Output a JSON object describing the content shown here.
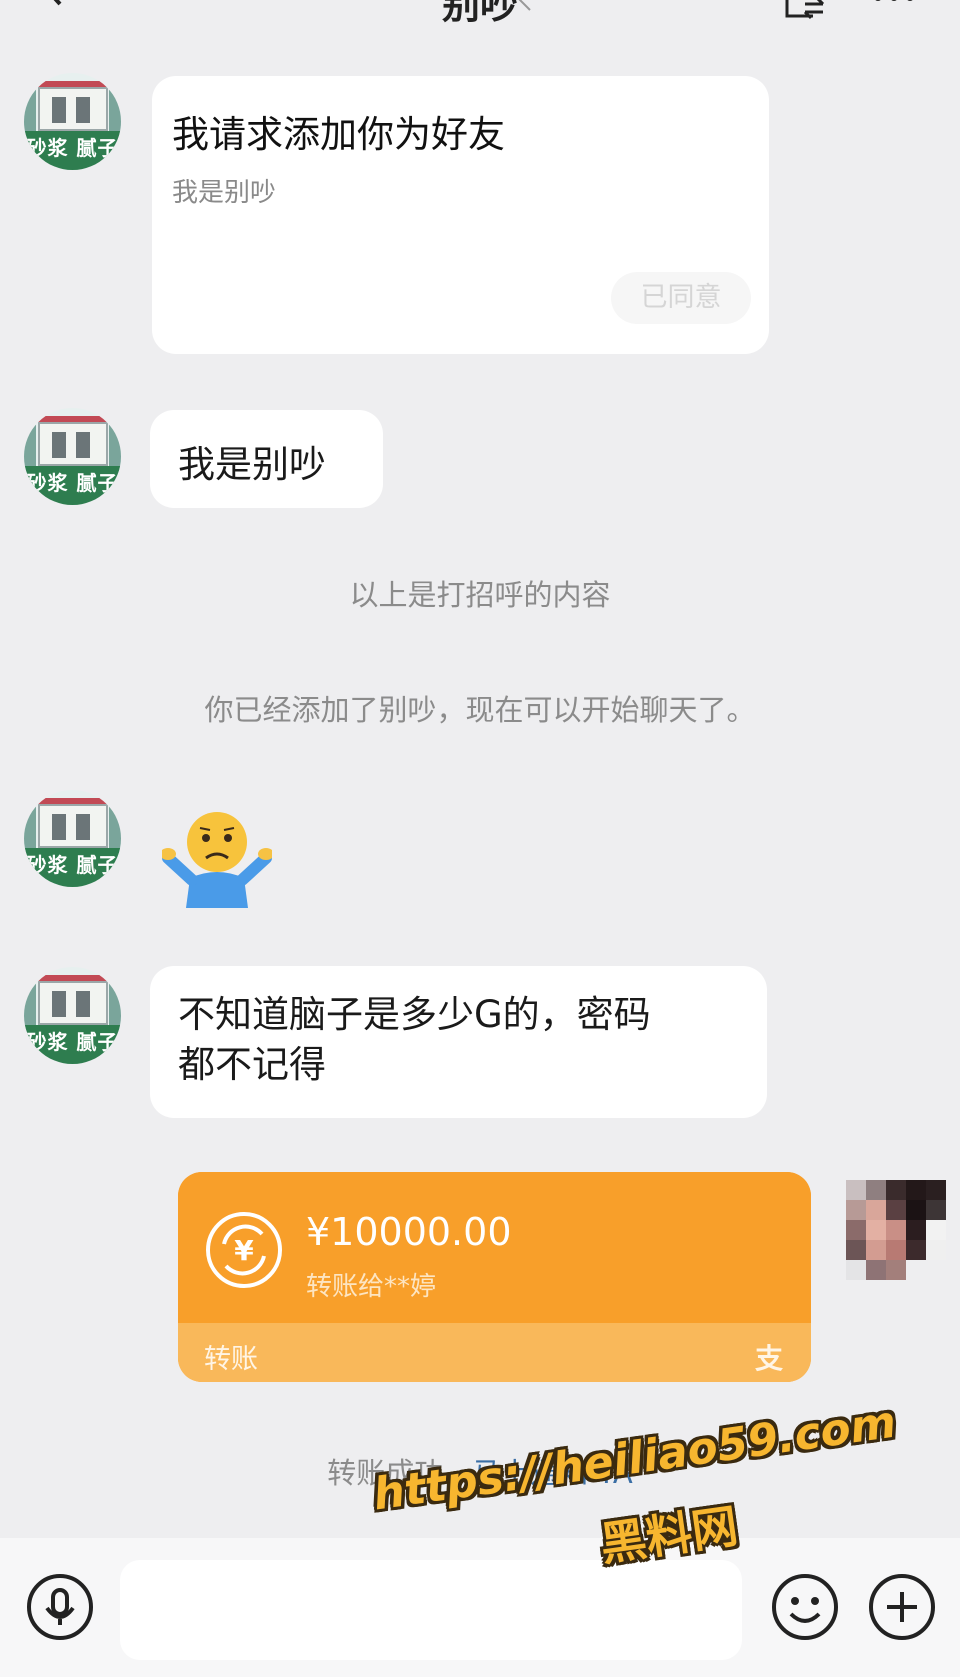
{
  "header": {
    "title": "别吵",
    "back_icon": "chevron-left-icon",
    "mute_icon": "mute-icon",
    "switch_icon": "switch-account-icon",
    "more_icon": "more-icon"
  },
  "contact": {
    "avatar_sign": "砂浆 腻子"
  },
  "messages": {
    "request_card": {
      "title": "我请求添加你为好友",
      "subtitle": "我是别吵",
      "status_button": "已同意"
    },
    "msg1": "我是别吵",
    "system_greeting": "以上是打招呼的内容",
    "system_added": "你已经添加了别吵，现在可以开始聊天了。",
    "emoji": "shrug-emoji",
    "msg2_line1": "不知道脑子是多少G的，密码",
    "msg2_line2": "都不记得"
  },
  "transfer": {
    "amount": "¥10000.00",
    "recipient": "转账给**婷",
    "label": "转账",
    "brand_mark": "支",
    "icon": "yuan-transfer-icon",
    "accent_color": "#f89f2a"
  },
  "transfer_status": {
    "text": "转账成功，",
    "link": "马上通知 TA"
  },
  "input_bar": {
    "placeholder": "",
    "mic_icon": "microphone-icon",
    "emoji_icon": "smiley-icon",
    "plus_icon": "plus-icon"
  },
  "watermark": {
    "url": "https://heiliao59.com",
    "name": "黑料网"
  }
}
